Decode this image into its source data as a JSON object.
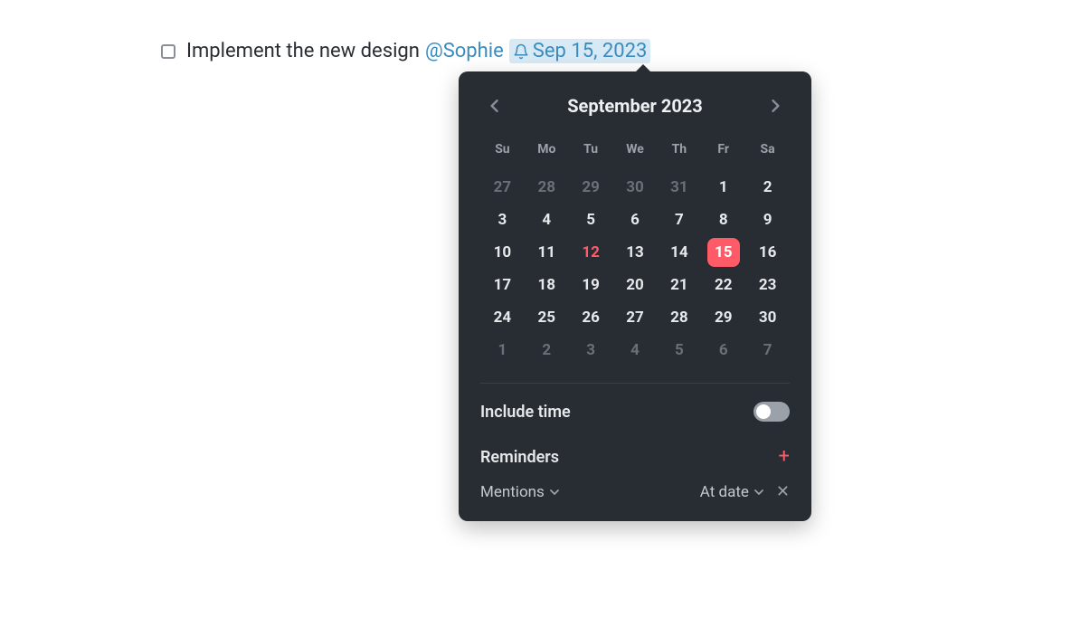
{
  "task": {
    "text": "Implement the new design",
    "mention": "@Sophie",
    "date_label": "Sep 15, 2023"
  },
  "calendar": {
    "title": "September 2023",
    "dow": [
      "Su",
      "Mo",
      "Tu",
      "We",
      "Th",
      "Fr",
      "Sa"
    ],
    "today": 12,
    "selected": 15,
    "weeks": [
      [
        {
          "n": 27,
          "o": true
        },
        {
          "n": 28,
          "o": true
        },
        {
          "n": 29,
          "o": true
        },
        {
          "n": 30,
          "o": true
        },
        {
          "n": 31,
          "o": true
        },
        {
          "n": 1
        },
        {
          "n": 2
        }
      ],
      [
        {
          "n": 3
        },
        {
          "n": 4
        },
        {
          "n": 5
        },
        {
          "n": 6
        },
        {
          "n": 7
        },
        {
          "n": 8
        },
        {
          "n": 9
        }
      ],
      [
        {
          "n": 10
        },
        {
          "n": 11
        },
        {
          "n": 12
        },
        {
          "n": 13
        },
        {
          "n": 14
        },
        {
          "n": 15
        },
        {
          "n": 16
        }
      ],
      [
        {
          "n": 17
        },
        {
          "n": 18
        },
        {
          "n": 19
        },
        {
          "n": 20
        },
        {
          "n": 21
        },
        {
          "n": 22
        },
        {
          "n": 23
        }
      ],
      [
        {
          "n": 24
        },
        {
          "n": 25
        },
        {
          "n": 26
        },
        {
          "n": 27
        },
        {
          "n": 28
        },
        {
          "n": 29
        },
        {
          "n": 30
        }
      ],
      [
        {
          "n": 1,
          "o": true
        },
        {
          "n": 2,
          "o": true
        },
        {
          "n": 3,
          "o": true
        },
        {
          "n": 4,
          "o": true
        },
        {
          "n": 5,
          "o": true
        },
        {
          "n": 6,
          "o": true
        },
        {
          "n": 7,
          "o": true
        }
      ]
    ]
  },
  "options": {
    "include_time_label": "Include time",
    "include_time_on": false,
    "reminders_label": "Reminders",
    "reminder_entry": {
      "type": "Mentions",
      "when": "At date"
    }
  }
}
